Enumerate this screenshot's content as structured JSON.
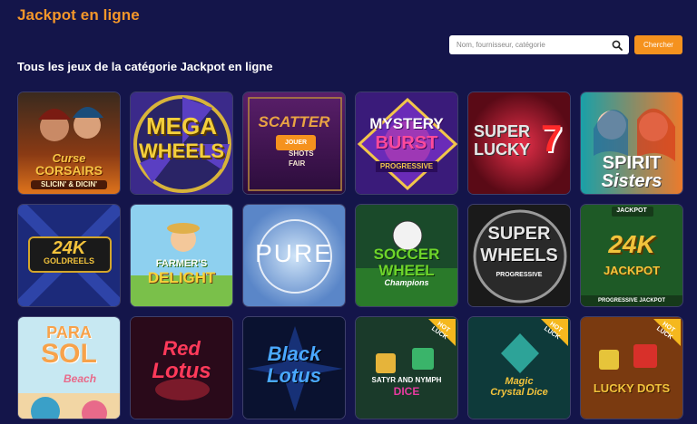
{
  "header": {
    "title": "Jackpot en ligne"
  },
  "search": {
    "placeholder": "Nom, fournisseur, catégorie",
    "button_label": "Chercher"
  },
  "section": {
    "title": "Tous les jeux de la catégorie Jackpot en ligne"
  },
  "play_label": "JOUER",
  "badge_label": "HOT LUCK",
  "games": [
    {
      "id": "curse-corsairs",
      "lines": [
        "Curse",
        "CORSAIRS",
        "SLICIN' & DICIN'"
      ]
    },
    {
      "id": "mega-wheels",
      "lines": [
        "MEGA",
        "WHEELS"
      ]
    },
    {
      "id": "scatter-shots",
      "lines": [
        "SCATTER",
        "SHOTS",
        "FAIR"
      ]
    },
    {
      "id": "mystery-burst",
      "lines": [
        "MYSTERY",
        "BURST",
        "PROGRESSIVE"
      ]
    },
    {
      "id": "super-lucky-7",
      "lines": [
        "SUPER",
        "LUCKY",
        "7"
      ]
    },
    {
      "id": "spirit-sisters",
      "lines": [
        "SPIRIT",
        "Sisters"
      ]
    },
    {
      "id": "24k-gold-reels",
      "lines": [
        "24K",
        "GOLDREELS"
      ]
    },
    {
      "id": "farmers-delight",
      "lines": [
        "FARMER'S",
        "DELIGHT"
      ]
    },
    {
      "id": "pure",
      "lines": [
        "PURE"
      ]
    },
    {
      "id": "soccer-wheel",
      "lines": [
        "SOCCER",
        "WHEEL",
        "Champions"
      ]
    },
    {
      "id": "super-wheels",
      "lines": [
        "SUPER",
        "WHEELS",
        "PROGRESSIVE"
      ]
    },
    {
      "id": "24k-jackpot",
      "lines": [
        "JACKPOT",
        "24K",
        "JACKPOT",
        "PROGRESSIVE JACKPOT"
      ]
    },
    {
      "id": "parasol-beach",
      "lines": [
        "PARA",
        "SOL",
        "Beach"
      ]
    },
    {
      "id": "red-lotus",
      "lines": [
        "Red",
        "Lotus"
      ]
    },
    {
      "id": "black-lotus",
      "lines": [
        "Black",
        "Lotus"
      ]
    },
    {
      "id": "satyr-and-nymph",
      "lines": [
        "SATYR AND NYMPH",
        "DICE"
      ]
    },
    {
      "id": "magic-crystal-dice",
      "lines": [
        "Magic",
        "Crystal Dice"
      ]
    },
    {
      "id": "lucky-dots",
      "lines": [
        "LUCKY DOTS"
      ]
    }
  ]
}
